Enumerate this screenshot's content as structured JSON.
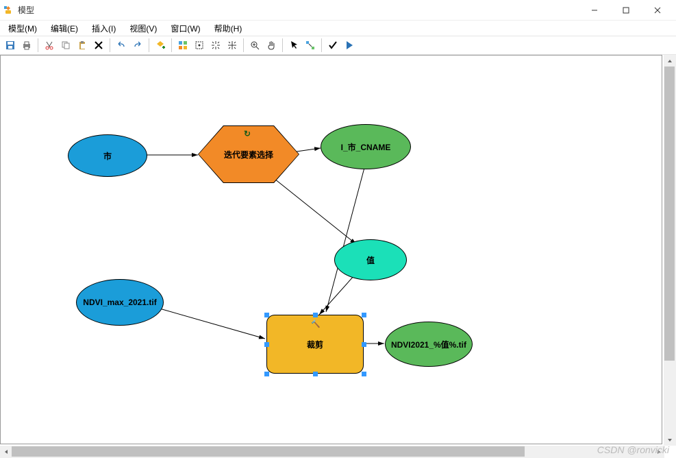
{
  "titlebar": {
    "title": "模型"
  },
  "menubar": {
    "model": "模型(M)",
    "edit": "编辑(E)",
    "insert": "插入(I)",
    "view": "视图(V)",
    "window": "窗口(W)",
    "help": "帮助(H)"
  },
  "nodes": {
    "shi": "市",
    "iterate": "迭代要素选择",
    "i_cname": "I_市_CNAME",
    "value": "值",
    "ndvi_in": "NDVI_max_2021.tif",
    "clip": "裁剪",
    "ndvi_out": "NDVI2021_%值%.tif"
  },
  "watermark": "CSDN @ronvicki"
}
